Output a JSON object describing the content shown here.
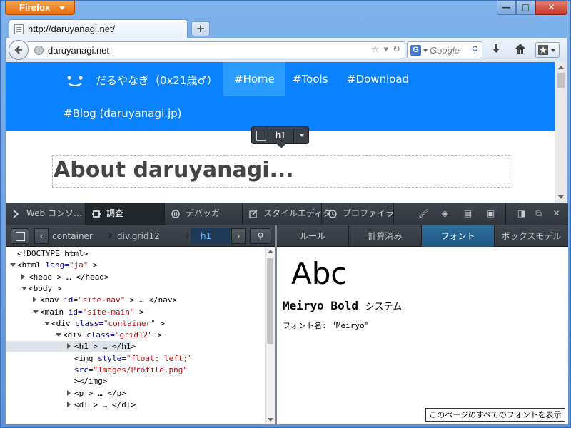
{
  "browser": {
    "app_button": "Firefox",
    "window_controls": {
      "minimize": "—",
      "maximize": "□",
      "close": "✕"
    },
    "tab": {
      "title": "http://daruyanagi.net/"
    },
    "new_tab": "+",
    "url": "daruyanagi.net",
    "search_placeholder": "Google",
    "search_engine_icon": "G"
  },
  "site": {
    "name": "だるやなぎ（0x21歳♂）",
    "nav": [
      {
        "label": "#Home",
        "active": true
      },
      {
        "label": "#Tools",
        "active": false
      },
      {
        "label": "#Download",
        "active": false
      },
      {
        "label": "#Blog (daruyanagi.jp)",
        "active": false
      }
    ],
    "heading": "About daruyanagi...",
    "accent_color": "#0a82ff"
  },
  "infobar": {
    "tag": "h1"
  },
  "devtools": {
    "tabs": [
      {
        "label": "Web コンソ…",
        "active": false
      },
      {
        "label": "調査",
        "active": true
      },
      {
        "label": "デバッガ",
        "active": false
      },
      {
        "label": "スタイルエディタ",
        "active": false
      },
      {
        "label": "プロファイラ",
        "active": false
      }
    ],
    "breadcrumbs": [
      "container",
      "div.grid12",
      "h1"
    ],
    "markup": [
      {
        "indent": 0,
        "tw": "",
        "parts": [
          [
            "tag",
            "<!DOCTYPE html>"
          ]
        ]
      },
      {
        "indent": 0,
        "tw": "open",
        "parts": [
          [
            "tag",
            "<html "
          ],
          [
            "attr",
            "lang="
          ],
          [
            "val",
            "\"ja\""
          ],
          [
            "tag",
            "  >"
          ]
        ]
      },
      {
        "indent": 1,
        "tw": "closed",
        "parts": [
          [
            "tag",
            "<head  > … </head>"
          ]
        ]
      },
      {
        "indent": 1,
        "tw": "open",
        "parts": [
          [
            "tag",
            "<body  >"
          ]
        ]
      },
      {
        "indent": 2,
        "tw": "closed",
        "parts": [
          [
            "tag",
            "<nav "
          ],
          [
            "attr",
            "id="
          ],
          [
            "val",
            "\"site-nav\""
          ],
          [
            "tag",
            "  > … </nav>"
          ]
        ]
      },
      {
        "indent": 2,
        "tw": "open",
        "parts": [
          [
            "tag",
            "<main "
          ],
          [
            "attr",
            "id="
          ],
          [
            "val",
            "\"site-main\""
          ],
          [
            "tag",
            "  >"
          ]
        ]
      },
      {
        "indent": 3,
        "tw": "open",
        "parts": [
          [
            "tag",
            "<div "
          ],
          [
            "attr",
            "class="
          ],
          [
            "val",
            "\"container\""
          ],
          [
            "tag",
            "  >"
          ]
        ]
      },
      {
        "indent": 4,
        "tw": "open",
        "parts": [
          [
            "tag",
            "<div "
          ],
          [
            "attr",
            "class="
          ],
          [
            "val",
            "\"grid12\""
          ],
          [
            "tag",
            "  >"
          ]
        ]
      },
      {
        "indent": 5,
        "tw": "closed",
        "hl": true,
        "parts": [
          [
            "tag",
            "<h1  > … </h1>"
          ]
        ]
      },
      {
        "indent": 5,
        "tw": "",
        "parts": [
          [
            "tag",
            "<img "
          ],
          [
            "attr",
            "style="
          ],
          [
            "val",
            "\"float: left;\""
          ]
        ]
      },
      {
        "indent": 5,
        "tw": "",
        "parts": [
          [
            "attr",
            "src="
          ],
          [
            "val",
            "\"Images/Profile.png\""
          ]
        ]
      },
      {
        "indent": 5,
        "tw": "",
        "parts": [
          [
            "tag",
            "></img>"
          ]
        ]
      },
      {
        "indent": 5,
        "tw": "closed",
        "parts": [
          [
            "tag",
            "<p  > … </p>"
          ]
        ]
      },
      {
        "indent": 5,
        "tw": "closed",
        "parts": [
          [
            "tag",
            "<dl  > … </dl>"
          ]
        ]
      }
    ],
    "side_tabs": [
      {
        "label": "ルール",
        "active": false
      },
      {
        "label": "計算済み",
        "active": false
      },
      {
        "label": "フォント",
        "active": true
      },
      {
        "label": "ボックスモデル",
        "active": false
      }
    ],
    "font_panel": {
      "preview": "Abc",
      "font_name": "Meiryo Bold",
      "font_origin": "システム",
      "font_label": "フォント名: \"Meiryo\"",
      "show_all_button": "このページのすべてのフォントを表示"
    }
  }
}
